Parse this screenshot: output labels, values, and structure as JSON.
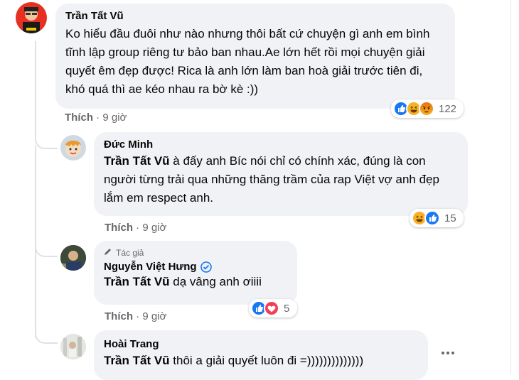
{
  "comments": [
    {
      "author": "Trần Tất Vũ",
      "text": "Ko hiểu đầu đuôi như nào nhưng thôi bất cứ chuyện gì anh em bình tĩnh lập group riêng tư bảo ban nhau.Ae lớn hết rồi mọi chuyện giải quyết êm đẹp được! Rica là anh lớn làm ban hoà giải trước tiên đi, khó quá thì ae kéo nhau ra bờ kè :))",
      "like_label": "Thích",
      "time": "9 giờ",
      "reaction_count": "122",
      "reactions": [
        "like",
        "haha",
        "angry"
      ]
    },
    {
      "author": "Đức Minh",
      "mention": "Trần Tất Vũ",
      "text": " à đấy anh Bíc nói chỉ có chính xác, đúng là con người từng trải qua những thăng trầm của rap Việt vợ anh đẹp lắm em respect anh.",
      "like_label": "Thích",
      "time": "9 giờ",
      "reaction_count": "15",
      "reactions": [
        "haha",
        "like"
      ]
    },
    {
      "badge": "Tác giả",
      "author": "Nguyễn Việt Hưng",
      "verified": true,
      "mention": "Trần Tất Vũ",
      "text": " dạ vâng anh ơiiii",
      "like_label": "Thích",
      "time": "9 giờ",
      "reaction_count": "5",
      "reactions": [
        "like",
        "love"
      ]
    },
    {
      "author": "Hoài Trang",
      "mention": "Trần Tất Vũ",
      "text": " thôi a giải quyết luôn đi =))))))))))))))",
      "more_icon": "more-horizontal-icon"
    }
  ],
  "separator": "·",
  "colors": {
    "like": "#1877f2",
    "love": "#f33e58",
    "haha": "#f7b125",
    "angry": "#e9710f",
    "verified": "#1877f2"
  }
}
